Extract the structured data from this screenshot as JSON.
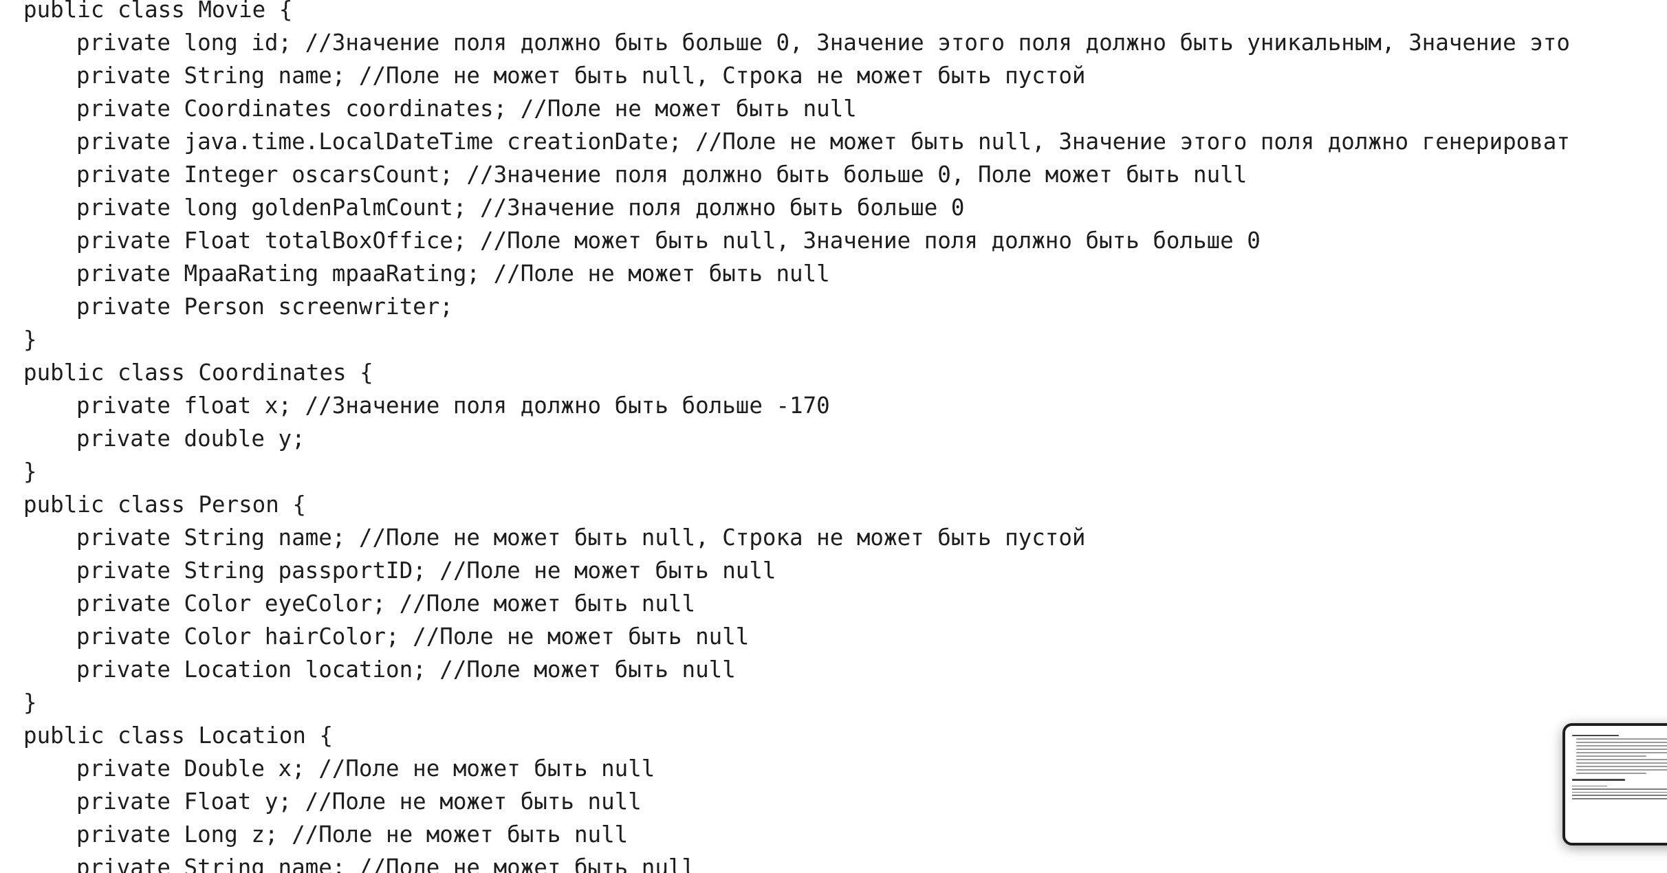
{
  "code": {
    "lines": [
      {
        "indent": false,
        "text": "public class Movie {"
      },
      {
        "indent": true,
        "text": "private long id; //Значение поля должно быть больше 0, Значение этого поля должно быть уникальным, Значение этого"
      },
      {
        "indent": true,
        "text": "private String name; //Поле не может быть null, Строка не может быть пустой"
      },
      {
        "indent": true,
        "text": "private Coordinates coordinates; //Поле не может быть null"
      },
      {
        "indent": true,
        "text": "private java.time.LocalDateTime creationDate; //Поле не может быть null, Значение этого поля должно генерировать"
      },
      {
        "indent": true,
        "text": "private Integer oscarsCount; //Значение поля должно быть больше 0, Поле может быть null"
      },
      {
        "indent": true,
        "text": "private long goldenPalmCount; //Значение поля должно быть больше 0"
      },
      {
        "indent": true,
        "text": "private Float totalBoxOffice; //Поле может быть null, Значение поля должно быть больше 0"
      },
      {
        "indent": true,
        "text": "private MpaaRating mpaaRating; //Поле не может быть null"
      },
      {
        "indent": true,
        "text": "private Person screenwriter;"
      },
      {
        "indent": false,
        "text": "}"
      },
      {
        "indent": false,
        "text": "public class Coordinates {"
      },
      {
        "indent": true,
        "text": "private float x; //Значение поля должно быть больше -170"
      },
      {
        "indent": true,
        "text": "private double y;"
      },
      {
        "indent": false,
        "text": "}"
      },
      {
        "indent": false,
        "text": "public class Person {"
      },
      {
        "indent": true,
        "text": "private String name; //Поле не может быть null, Строка не может быть пустой"
      },
      {
        "indent": true,
        "text": "private String passportID; //Поле не может быть null"
      },
      {
        "indent": true,
        "text": "private Color eyeColor; //Поле может быть null"
      },
      {
        "indent": true,
        "text": "private Color hairColor; //Поле не может быть null"
      },
      {
        "indent": true,
        "text": "private Location location; //Поле может быть null"
      },
      {
        "indent": false,
        "text": "}"
      },
      {
        "indent": false,
        "text": "public class Location {"
      },
      {
        "indent": true,
        "text": "private Double x; //Поле не может быть null"
      },
      {
        "indent": true,
        "text": "private Float y; //Поле не может быть null"
      },
      {
        "indent": true,
        "text": "private Long z; //Поле не может быть null"
      },
      {
        "indent": true,
        "text": "private String name; //Поле не может быть null"
      }
    ]
  },
  "thumbnail": {
    "icon": "screenshot-thumbnail"
  }
}
